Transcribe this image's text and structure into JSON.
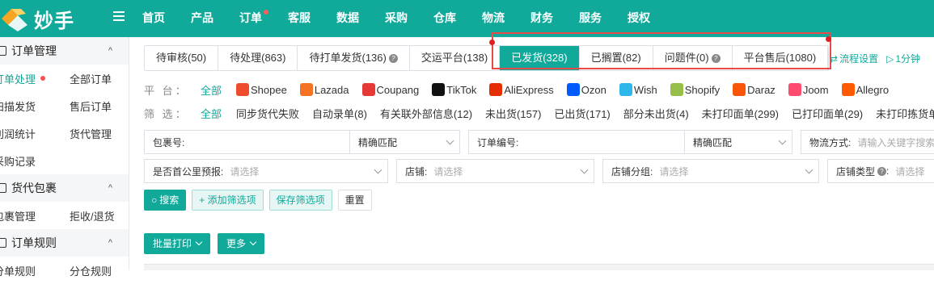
{
  "brand": {
    "logo_text": "妙手"
  },
  "topnav": [
    {
      "label": "首页"
    },
    {
      "label": "产品"
    },
    {
      "label": "订单",
      "dot": true
    },
    {
      "label": "客服"
    },
    {
      "label": "数据"
    },
    {
      "label": "采购"
    },
    {
      "label": "仓库"
    },
    {
      "label": "物流"
    },
    {
      "label": "财务"
    },
    {
      "label": "服务"
    },
    {
      "label": "授权"
    }
  ],
  "sidebar": {
    "groups": [
      {
        "title": "订单管理",
        "rows": [
          [
            "订单处理",
            "全部订单"
          ],
          [
            "扫描发货",
            "售后订单"
          ],
          [
            "利润统计",
            "货代管理"
          ],
          [
            "采购记录",
            ""
          ]
        ]
      },
      {
        "title": "货代包裹",
        "rows": [
          [
            "包裹管理",
            "拒收/退货"
          ]
        ]
      },
      {
        "title": "订单规则",
        "rows": [
          [
            "分单规则",
            "分仓规则"
          ]
        ]
      }
    ]
  },
  "tabs": [
    {
      "label": "待审核(50)"
    },
    {
      "label": "待处理(863)"
    },
    {
      "label": "待打单发货(136)",
      "help": true
    },
    {
      "label": "交运平台(138)"
    },
    {
      "label": "已发货(328)",
      "active": true
    },
    {
      "label": "已搁置(82)"
    },
    {
      "label": "问题件(0)",
      "help": true
    },
    {
      "label": "平台售后(1080)"
    }
  ],
  "tab_links": {
    "flow": "流程设置",
    "oneclick": "1分钟"
  },
  "platform_filter": {
    "label": "平 台：",
    "options": [
      "全部",
      "Shopee",
      "Lazada",
      "Coupang",
      "TikTok",
      "AliExpress",
      "Ozon",
      "Wish",
      "Shopify",
      "Daraz",
      "Joom",
      "Allegro"
    ],
    "colors": [
      "",
      "#ee4d2d",
      "#f57224",
      "#e53935",
      "#111111",
      "#e62e04",
      "#005bff",
      "#2fb7ec",
      "#95bf47",
      "#f85606",
      "#ff4b6e",
      "#ff5a00"
    ]
  },
  "status_filter": {
    "label": "筛 选：",
    "options": [
      "全部",
      "同步货代失败",
      "自动录单(8)",
      "有关联外部信息(12)",
      "未出货(157)",
      "已出货(171)",
      "部分未出货(4)",
      "未打印面单(299)",
      "已打印面单(29)",
      "未打印拣货单"
    ]
  },
  "search": {
    "package_no": {
      "label": "包裹号:",
      "match": "精确匹配"
    },
    "order_no": {
      "label": "订单编号:",
      "match": "精确匹配"
    },
    "shipping": {
      "label": "物流方式:",
      "placeholder": "请输入关键字搜索"
    },
    "overseas": {
      "label": "是否首公里预报:",
      "placeholder": "请选择"
    },
    "store": {
      "label": "店铺:",
      "placeholder": "请选择"
    },
    "store_group": {
      "label": "店铺分组:",
      "placeholder": "请选择"
    },
    "store_type": {
      "label": "店铺类型",
      "placeholder": "请选择"
    }
  },
  "actions": {
    "search": "搜索",
    "add_filter": "+ 添加筛选项",
    "save_filter": "保存筛选项",
    "reset": "重置"
  },
  "bulk": {
    "print": "批量打印",
    "more": "更多"
  }
}
